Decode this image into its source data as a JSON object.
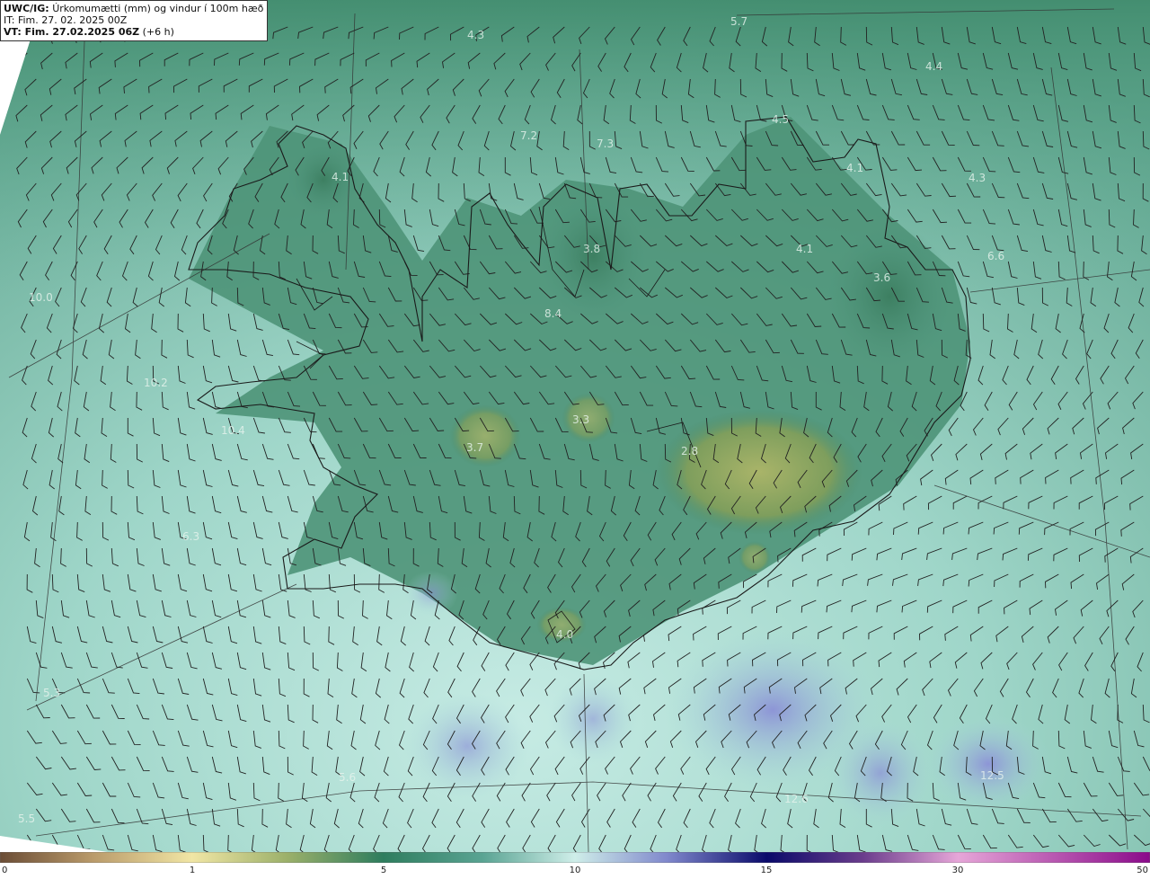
{
  "header": {
    "product": "UWC/IG:",
    "title": "Úrkomumætti (mm) og vindur í 100m hæð",
    "init_time": "IT: Fim. 27. 02. 2025 00Z",
    "valid_time": "VT: Fim. 27.02.2025 06Z",
    "lead": "(+6 h)"
  },
  "colors": {
    "sea_light": "#a9dcd3",
    "sea_mid": "#6fb7a2",
    "land_green": "#3f8a6b",
    "land_olive": "#8ea85a",
    "snow_blue": "#9aa4dc",
    "coast": "#1a1a1a",
    "grid": "#333333"
  },
  "labels": [
    {
      "text": "4.3"
    },
    {
      "text": "5.7"
    },
    {
      "text": "4.4"
    },
    {
      "text": "4.5"
    },
    {
      "text": "7.2"
    },
    {
      "text": "7.3"
    },
    {
      "text": "4.1"
    },
    {
      "text": "4.1"
    },
    {
      "text": "4.3"
    },
    {
      "text": "4.1"
    },
    {
      "text": "3.8"
    },
    {
      "text": "6.6"
    },
    {
      "text": "3.6"
    },
    {
      "text": "10.0"
    },
    {
      "text": "8.4"
    },
    {
      "text": "10.2"
    },
    {
      "text": "3.3"
    },
    {
      "text": "10.4"
    },
    {
      "text": "3.7"
    },
    {
      "text": "2.8"
    },
    {
      "text": "6.3"
    },
    {
      "text": "4.0"
    },
    {
      "text": "5.3"
    },
    {
      "text": "5.6"
    },
    {
      "text": "12.6"
    },
    {
      "text": "12.5"
    },
    {
      "text": "5.5"
    }
  ],
  "legend": {
    "ticks": [
      "0",
      "1",
      "5",
      "10",
      "15",
      "30",
      "50"
    ]
  }
}
